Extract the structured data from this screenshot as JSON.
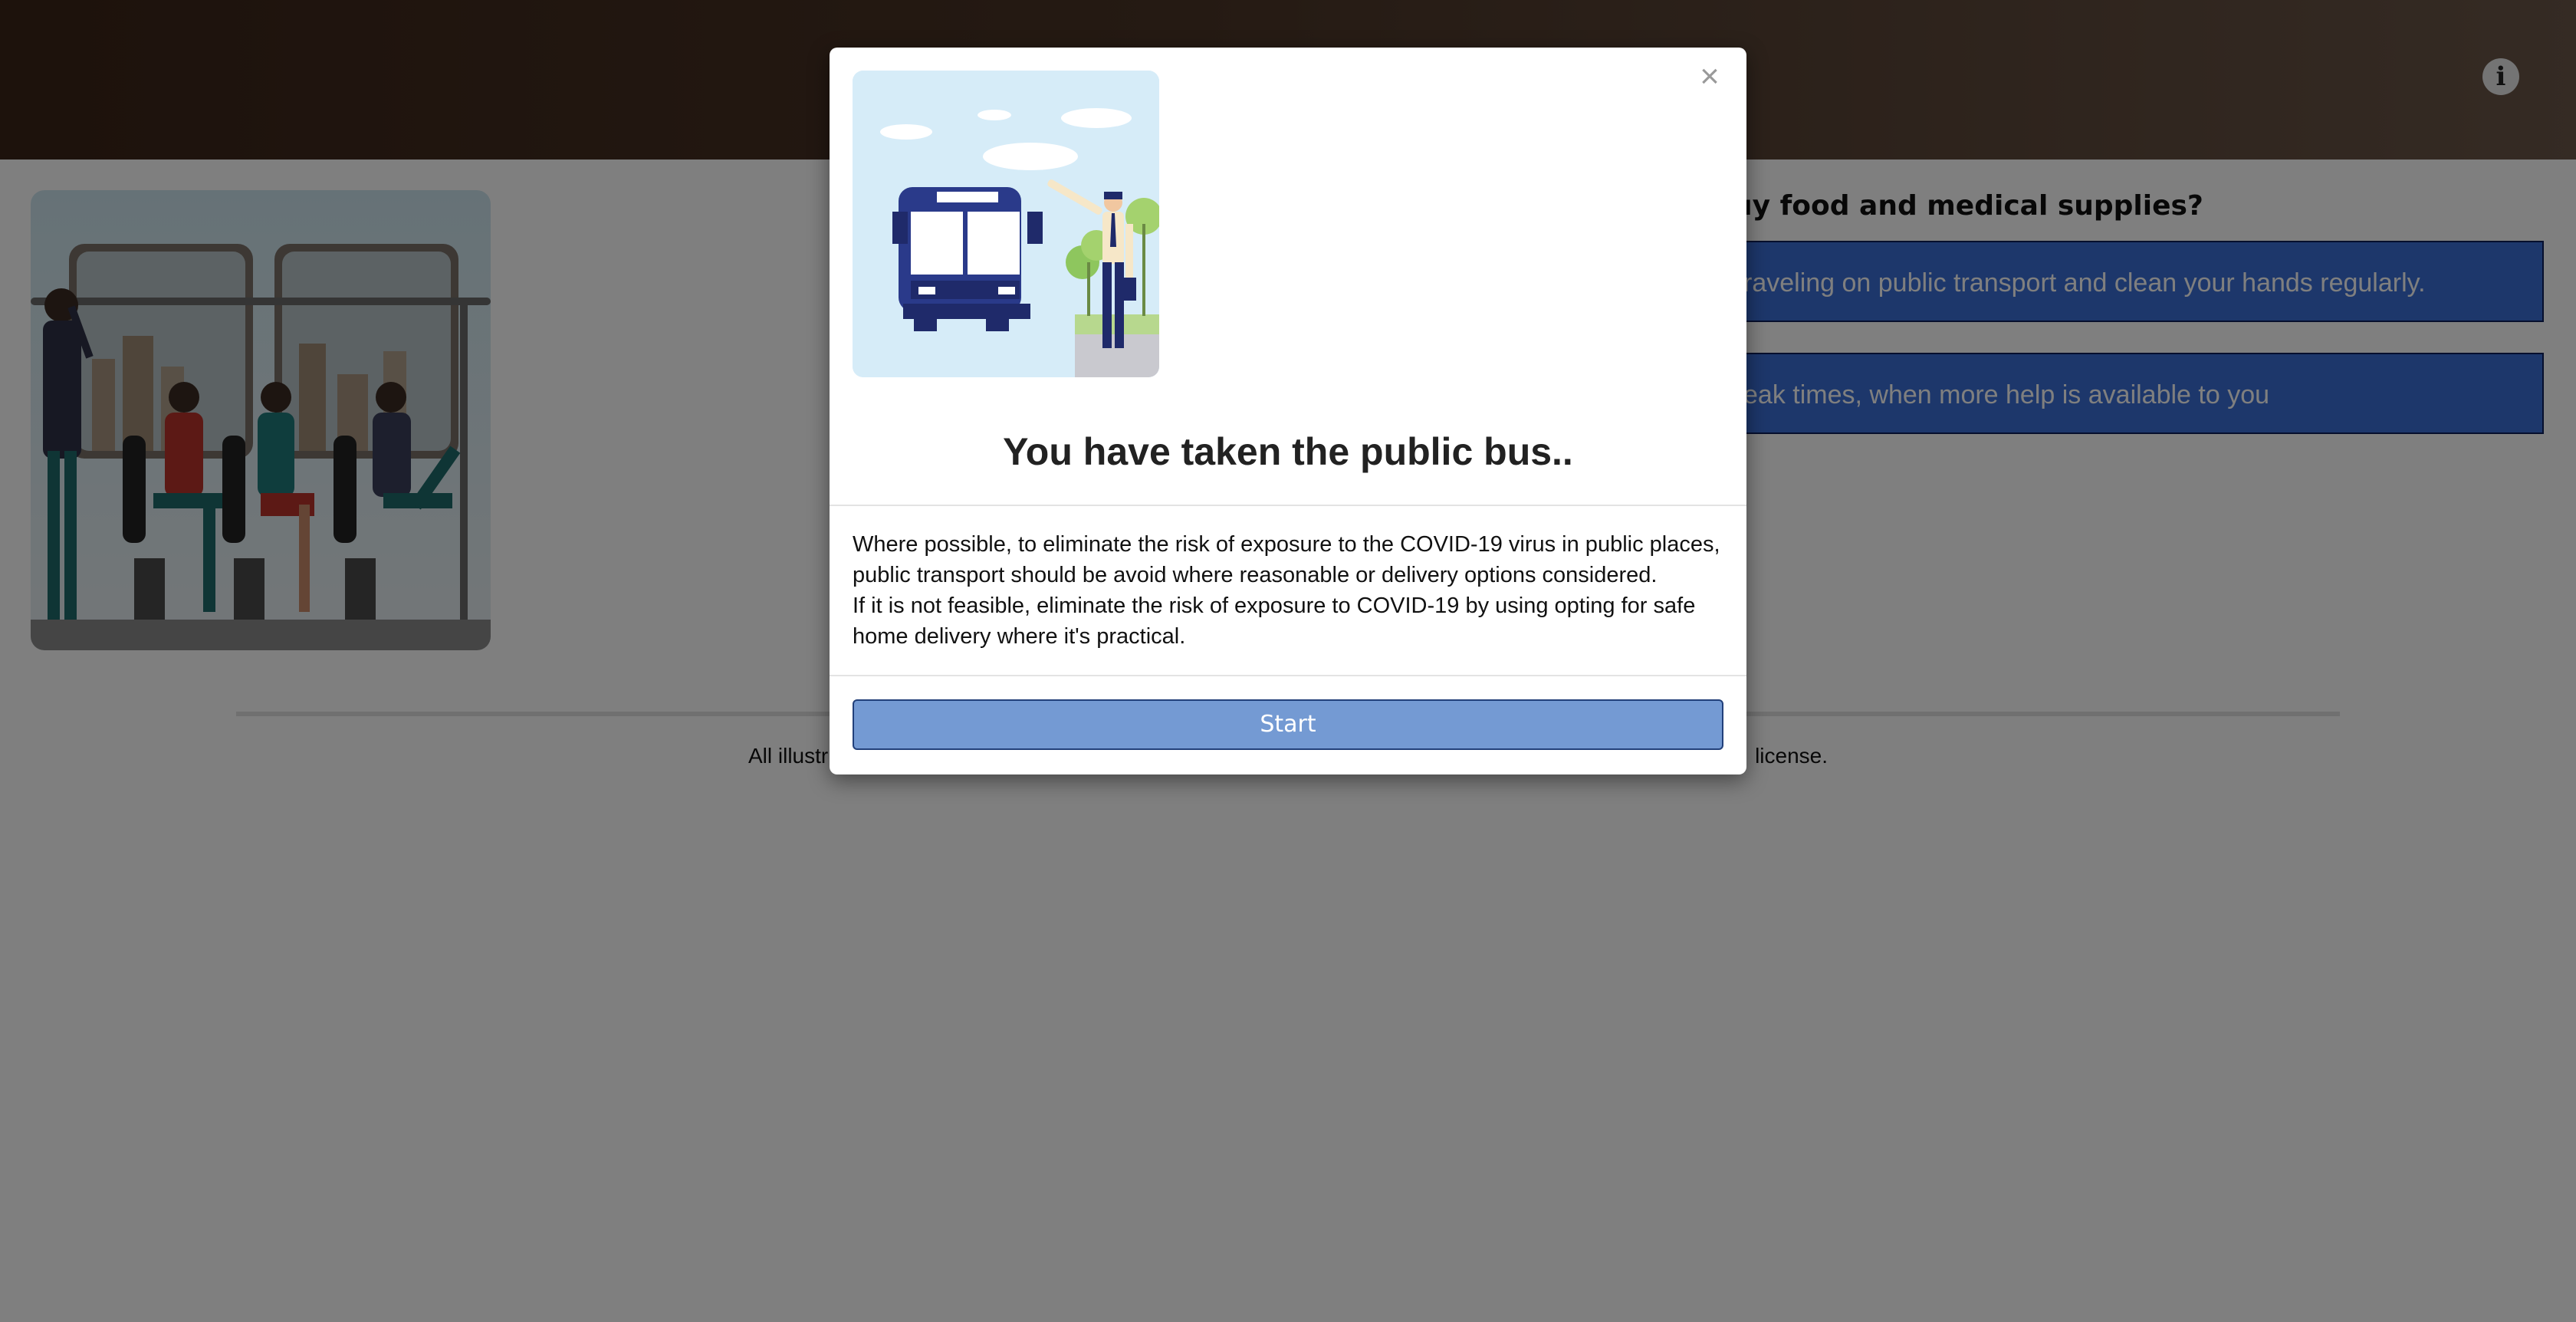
{
  "background_page": {
    "question_visible": "uy food and medical supplies?",
    "answers": [
      "raveling on public transport and clean your hands regularly.",
      "eak times, when more help is available to you"
    ],
    "footer_left_visible": "All illustr",
    "footer_right_visible": " license.",
    "info_icon": "info-icon"
  },
  "modal": {
    "close_label": "×",
    "illustration": "bus-stop-illustration",
    "title": "You have taken the public bus..",
    "body": [
      "Where possible, to eliminate the risk of exposure to the COVID-19 virus in public places, public transport should be avoid where reasonable or delivery options considered.",
      "If it is not feasible, eliminate the risk of exposure to COVID-19 by using opting for safe home delivery where it's practical."
    ],
    "start_label": "Start"
  },
  "colors": {
    "answer_bg": "#3b6fd6",
    "start_button": "#749ad3",
    "overlay": "rgba(0,0,0,0.5)"
  }
}
